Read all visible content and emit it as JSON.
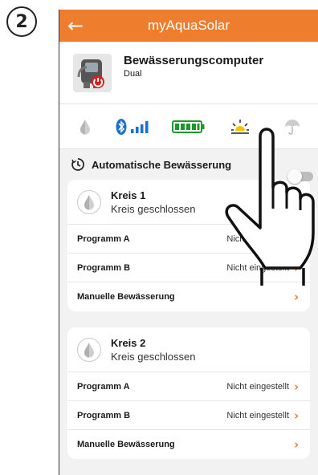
{
  "step": {
    "number": "2"
  },
  "app": {
    "title": "myAquaSolar",
    "back_icon": "arrow-left-icon",
    "accent": "#ef7d2e"
  },
  "device": {
    "name": "Bewässerungscomputer",
    "model": "Dual"
  },
  "status_icons": [
    "water-drop-icon",
    "bluetooth-signal-icon",
    "battery-icon",
    "sun-icon",
    "umbrella-icon"
  ],
  "auto": {
    "label": "Automatische Bewässerung",
    "enabled": false
  },
  "circuits": [
    {
      "title": "Kreis 1",
      "status": "Kreis geschlossen",
      "rows": [
        {
          "label": "Programm A",
          "value": "Nicht eingestellt"
        },
        {
          "label": "Programm B",
          "value": "Nicht eingestellt"
        },
        {
          "label": "Manuelle Bewässerung",
          "value": ""
        }
      ]
    },
    {
      "title": "Kreis 2",
      "status": "Kreis geschlossen",
      "rows": [
        {
          "label": "Programm A",
          "value": "Nicht eingestellt"
        },
        {
          "label": "Programm B",
          "value": "Nicht eingestellt"
        },
        {
          "label": "Manuelle Bewässerung",
          "value": ""
        }
      ]
    }
  ]
}
